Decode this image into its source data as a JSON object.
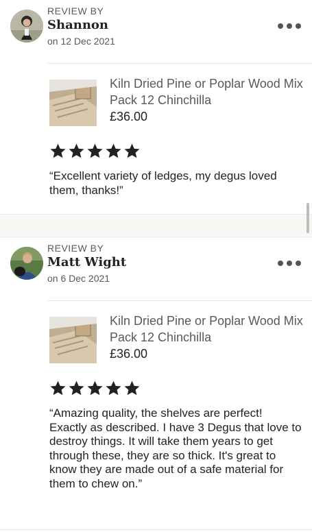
{
  "reviews": [
    {
      "review_by_label": "REVIEW BY",
      "reviewer": "Shannon",
      "date": "on 12 Dec 2021",
      "product_title": "Kiln Dried Pine or Poplar Wood Mix Pack 12 Chinchilla",
      "price": "£36.00",
      "rating": 5,
      "text": "“Excellent variety of ledges, my degus loved them, thanks!”"
    },
    {
      "review_by_label": "REVIEW BY",
      "reviewer": "Matt Wight",
      "date": "on 6 Dec 2021",
      "product_title": "Kiln Dried Pine or Poplar Wood Mix Pack 12 Chinchilla",
      "price": "£36.00",
      "rating": 5,
      "text": "“Amazing quality, the shelves are perfect! Exactly as described. I have 3 Degus that love to destroy things. It will take them years to get through these, they are so thick. It's great to know they are made out of a safe material for them to chew on.”"
    }
  ],
  "icons": {
    "more": "more-options-icon",
    "star": "star-icon"
  },
  "colors": {
    "star": "#222222",
    "muted_text": "#595959",
    "separator_bg": "#f7f7f3"
  }
}
